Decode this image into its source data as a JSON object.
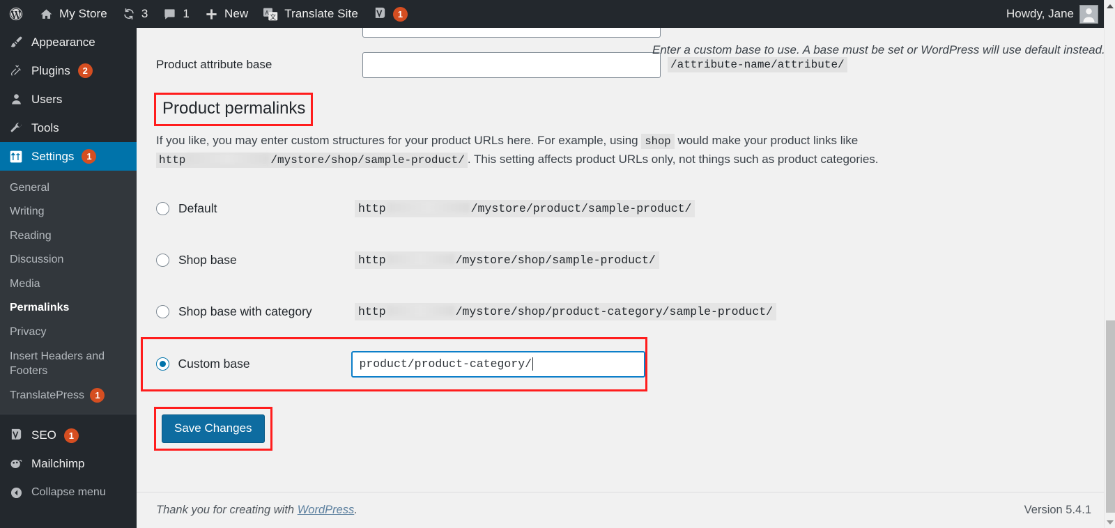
{
  "adminbar": {
    "logo_icon": "wordpress-logo-icon",
    "site_name": "My Store",
    "site_icon": "home-icon",
    "updates_icon": "updates-icon",
    "updates_count": "3",
    "comments_icon": "comments-icon",
    "comments_count": "1",
    "new_icon": "plus-icon",
    "new_label": "New",
    "translate_icon": "translate-icon",
    "translate_label": "Translate Site",
    "seo_icon": "yoast-seo-icon",
    "seo_count": "1",
    "howdy": "Howdy, Jane",
    "avatar_icon": "user-avatar-icon"
  },
  "sidebar": {
    "top_items": [
      {
        "label": "Appearance",
        "icon": "paintbrush-icon",
        "badge": "",
        "current": false
      },
      {
        "label": "Plugins",
        "icon": "plug-icon",
        "badge": "2",
        "current": false
      },
      {
        "label": "Users",
        "icon": "user-icon",
        "badge": "",
        "current": false
      },
      {
        "label": "Tools",
        "icon": "wrench-icon",
        "badge": "",
        "current": false
      },
      {
        "label": "Settings",
        "icon": "settings-sliders-icon",
        "badge": "1",
        "current": true
      }
    ],
    "submenu": [
      {
        "label": "General",
        "badge": "",
        "current": false
      },
      {
        "label": "Writing",
        "badge": "",
        "current": false
      },
      {
        "label": "Reading",
        "badge": "",
        "current": false
      },
      {
        "label": "Discussion",
        "badge": "",
        "current": false
      },
      {
        "label": "Media",
        "badge": "",
        "current": false
      },
      {
        "label": "Permalinks",
        "badge": "",
        "current": true
      },
      {
        "label": "Privacy",
        "badge": "",
        "current": false
      },
      {
        "label": "Insert Headers and Footers",
        "badge": "",
        "current": false
      },
      {
        "label": "TranslatePress",
        "badge": "1",
        "current": false
      }
    ],
    "bottom_items": [
      {
        "label": "SEO",
        "icon": "yoast-seo-icon",
        "badge": "1"
      },
      {
        "label": "Mailchimp",
        "icon": "mailchimp-icon",
        "badge": ""
      }
    ],
    "collapse_label": "Collapse menu",
    "collapse_icon": "collapse-arrow-icon"
  },
  "main": {
    "cut_off_input_value": "product-category/",
    "attribute_base": {
      "label": "Product attribute base",
      "value": "",
      "placeholder": "",
      "hint": "/attribute-name/attribute/"
    },
    "section": {
      "title": "Product permalinks",
      "desc_part1": "If you like, you may enter custom structures for your product URLs here. For example, using",
      "desc_code": "shop",
      "desc_part2": "would make your product links like",
      "desc_url_prefix": "http",
      "desc_url_suffix": "/mystore/shop/sample-product/",
      "desc_part3": ". This setting affects product URLs only, not things such as product categories."
    },
    "options": [
      {
        "label": "Default",
        "url_prefix": "http",
        "url_suffix": "/mystore/product/sample-product/",
        "selected": false
      },
      {
        "label": "Shop base",
        "url_prefix": "http",
        "url_suffix": "/mystore/shop/sample-product/",
        "selected": false
      },
      {
        "label": "Shop base with category",
        "url_prefix": "http",
        "url_suffix": "/mystore/shop/product-category/sample-product/",
        "selected": false
      }
    ],
    "custom": {
      "label": "Custom base",
      "value": "product/product-category/",
      "help": "Enter a custom base to use. A base must be set or WordPress will use default instead.",
      "selected": true
    },
    "save_label": "Save Changes"
  },
  "footer": {
    "thanks_prefix": "Thank you for creating with",
    "thanks_link": "WordPress",
    "thanks_suffix": ".",
    "version": "Version 5.4.1"
  },
  "colors": {
    "admin_dark": "#23282d",
    "submenu_dark": "#32373c",
    "accent_blue": "#0073aa",
    "badge_orange": "#d54e21",
    "highlight_red": "#ff1d1d",
    "button_blue": "#0e6ca0",
    "focus_blue": "#0d7fc9"
  }
}
